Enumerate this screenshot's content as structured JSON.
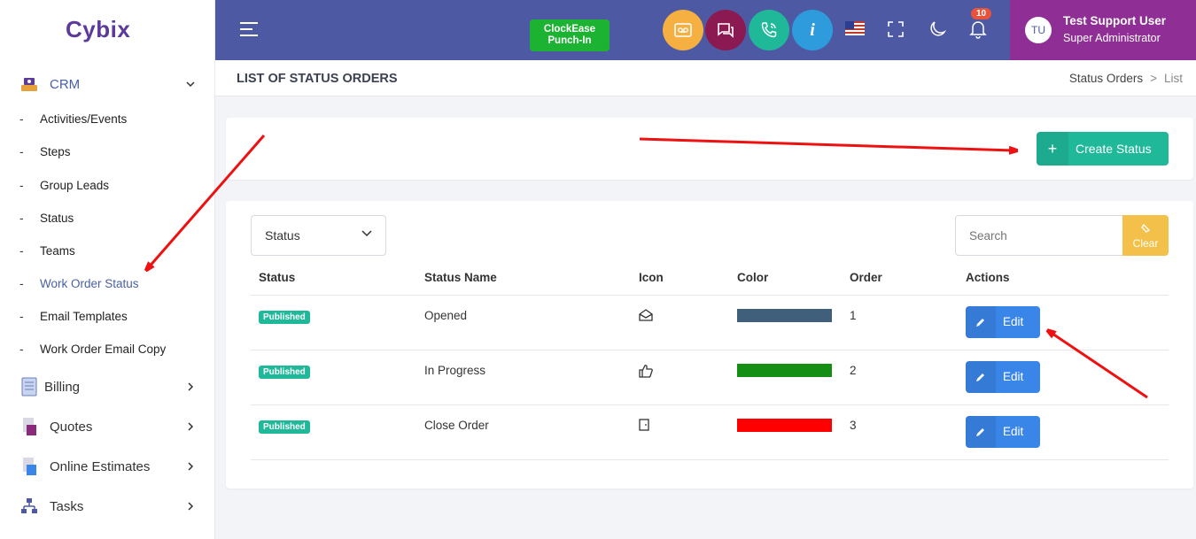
{
  "app": {
    "logo": "Cybix"
  },
  "sidebar": {
    "crm": {
      "label": "CRM",
      "icon": "crm-icon"
    },
    "crm_items": [
      {
        "label": "Activities/Events"
      },
      {
        "label": "Steps"
      },
      {
        "label": "Group Leads"
      },
      {
        "label": "Status"
      },
      {
        "label": "Teams"
      },
      {
        "label": "Work Order Status",
        "active": true
      },
      {
        "label": "Email Templates"
      },
      {
        "label": "Work Order Email Copy"
      }
    ],
    "groups": [
      {
        "label": "Billing",
        "icon": "billing-icon"
      },
      {
        "label": "Quotes",
        "icon": "quotes-icon"
      },
      {
        "label": "Online Estimates",
        "icon": "estimates-icon"
      },
      {
        "label": "Tasks",
        "icon": "tasks-icon"
      }
    ]
  },
  "topbar": {
    "clock_label": "ClockEase Punch-In",
    "notifications_count": "10",
    "user": {
      "initials": "TU",
      "name": "Test Support User",
      "role": "Super Administrator"
    },
    "colors": {
      "bar": "#4d5aa3",
      "user_box": "#8f2f95",
      "voicemail": "#f5b041",
      "chat": "#8b1a52",
      "phone": "#1fb99a",
      "info": "#2e9bdc"
    }
  },
  "page": {
    "title": "LIST OF STATUS ORDERS",
    "breadcrumb": [
      "Status Orders",
      "List"
    ]
  },
  "actions": {
    "create_label": "Create Status",
    "create_icon": "plus-icon"
  },
  "filters": {
    "select_value": "Status",
    "search_placeholder": "Search",
    "clear_label": "Clear"
  },
  "table": {
    "columns": [
      "Status",
      "Status Name",
      "Icon",
      "Color",
      "Order",
      "Actions"
    ],
    "rows": [
      {
        "status": "Published",
        "name": "Opened",
        "icon": "envelope-open-icon",
        "color": "#3f5f7a",
        "order": "1",
        "action": "Edit"
      },
      {
        "status": "Published",
        "name": "In Progress",
        "icon": "thumbs-up-icon",
        "color": "#148f14",
        "order": "2",
        "action": "Edit"
      },
      {
        "status": "Published",
        "name": "Close Order",
        "icon": "door-icon",
        "color": "#ff0000",
        "order": "3",
        "action": "Edit"
      }
    ]
  }
}
